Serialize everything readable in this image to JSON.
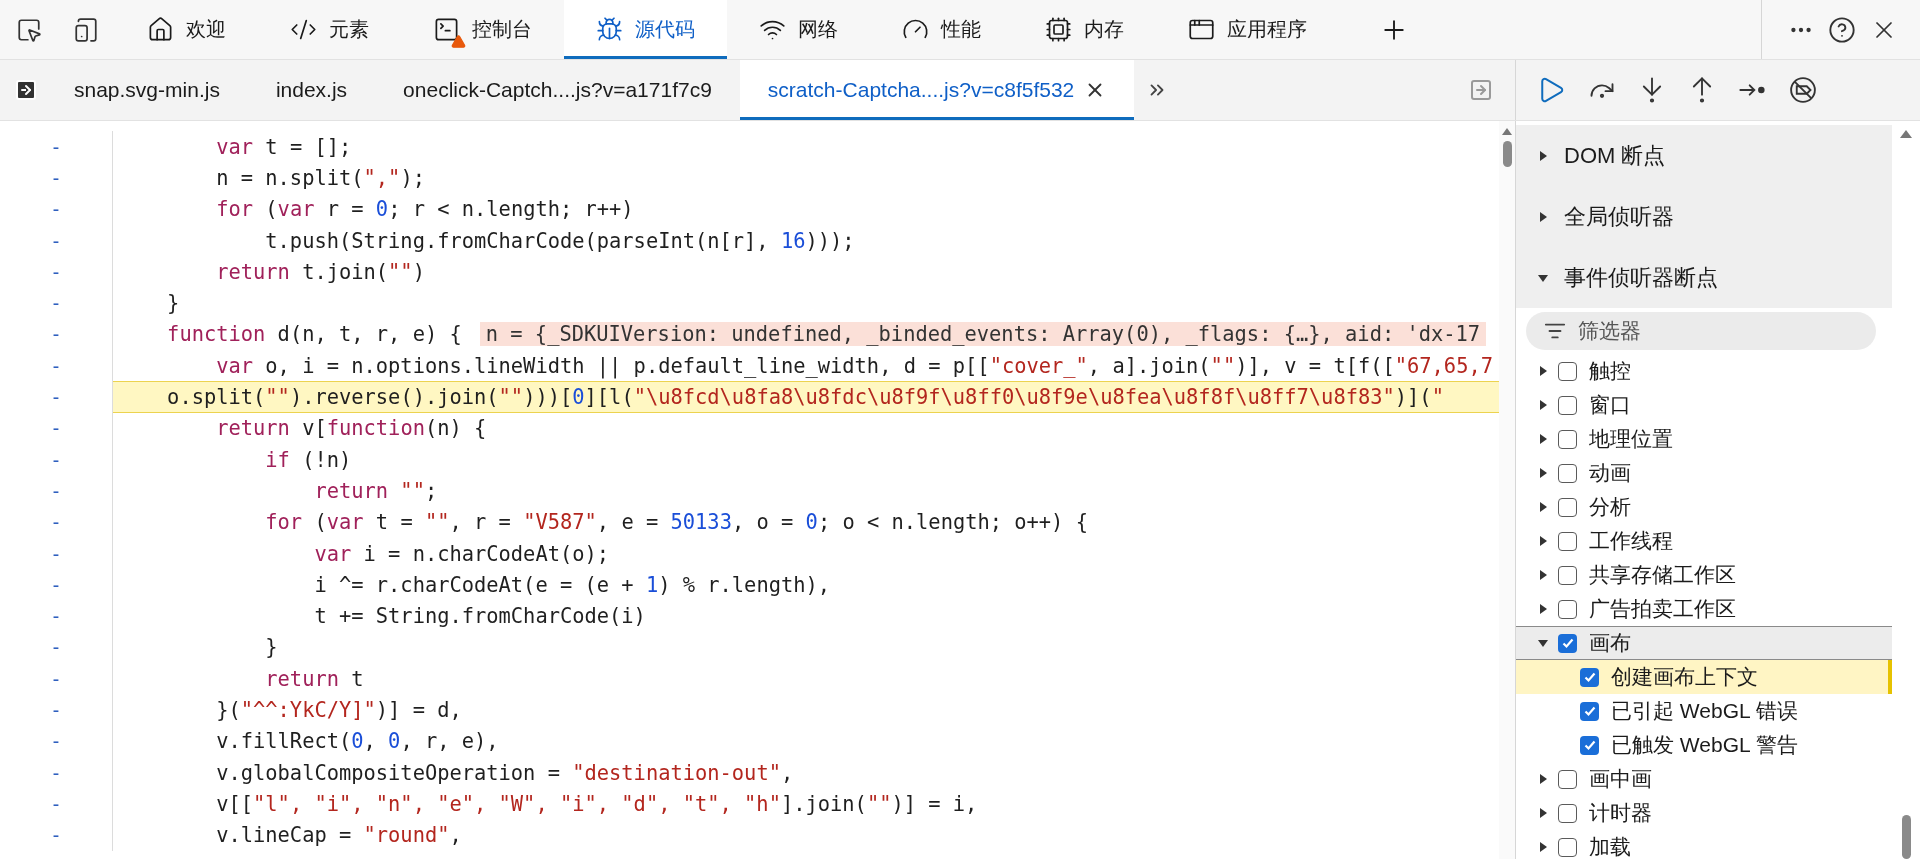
{
  "toolbar": {
    "tabs": [
      {
        "label": "欢迎",
        "selected": false,
        "warning": false
      },
      {
        "label": "元素",
        "selected": false,
        "warning": false
      },
      {
        "label": "控制台",
        "selected": false,
        "warning": true
      },
      {
        "label": "源代码",
        "selected": true,
        "warning": false
      },
      {
        "label": "网络",
        "selected": false,
        "warning": false
      },
      {
        "label": "性能",
        "selected": false,
        "warning": false
      },
      {
        "label": "内存",
        "selected": false,
        "warning": false
      },
      {
        "label": "应用程序",
        "selected": false,
        "warning": false
      }
    ]
  },
  "file_tabs": [
    {
      "label": "snap.svg-min.js",
      "selected": false
    },
    {
      "label": "index.js",
      "selected": false
    },
    {
      "label": "oneclick-Captch....js?v=a171f7c9",
      "selected": false
    },
    {
      "label": "scratch-Captcha....js?v=c8f5f532",
      "selected": true
    }
  ],
  "editor": {
    "lines": [
      {
        "gutter": "-",
        "paused": false,
        "code": [
          {
            "kind": "keyword",
            "text": "        var"
          },
          {
            "kind": "plain",
            "text": " t = [];"
          }
        ]
      },
      {
        "gutter": "-",
        "paused": false,
        "code": [
          {
            "kind": "plain",
            "text": "        n = n.split("
          },
          {
            "kind": "string",
            "text": "\",\""
          },
          {
            "kind": "plain",
            "text": ");"
          }
        ]
      },
      {
        "gutter": "-",
        "paused": false,
        "code": [
          {
            "kind": "keyword",
            "text": "        for"
          },
          {
            "kind": "plain",
            "text": " ("
          },
          {
            "kind": "keyword",
            "text": "var"
          },
          {
            "kind": "plain",
            "text": " r = "
          },
          {
            "kind": "number",
            "text": "0"
          },
          {
            "kind": "plain",
            "text": "; r < n.length; r++)"
          }
        ]
      },
      {
        "gutter": "-",
        "paused": false,
        "code": [
          {
            "kind": "plain",
            "text": "            t.push(String.fromCharCode(parseInt(n[r], "
          },
          {
            "kind": "number",
            "text": "16"
          },
          {
            "kind": "plain",
            "text": ")));"
          }
        ]
      },
      {
        "gutter": "-",
        "paused": false,
        "code": [
          {
            "kind": "keyword",
            "text": "        return"
          },
          {
            "kind": "plain",
            "text": " t.join("
          },
          {
            "kind": "string",
            "text": "\"\""
          },
          {
            "kind": "plain",
            "text": ")"
          }
        ]
      },
      {
        "gutter": "-",
        "paused": false,
        "code": [
          {
            "kind": "plain",
            "text": "    }"
          }
        ]
      },
      {
        "gutter": "-",
        "paused": false,
        "code": [
          {
            "kind": "keyword",
            "text": "    function"
          },
          {
            "kind": "plain",
            "text": " d(n, t, r, e) {"
          }
        ],
        "inline_value": "n = {_SDKUIVersion: undefined, _binded_events: Array(0), _flags: {…}, aid: 'dx-17"
      },
      {
        "gutter": "-",
        "paused": false,
        "code": [
          {
            "kind": "keyword",
            "text": "        var"
          },
          {
            "kind": "plain",
            "text": " o, i = n.options.lineWidth || p.default_line_width, d = p[["
          },
          {
            "kind": "string",
            "text": "\"cover_\""
          },
          {
            "kind": "plain",
            "text": ", a].join("
          },
          {
            "kind": "string",
            "text": "\"\""
          },
          {
            "kind": "plain",
            "text": ")], v = t[f(["
          },
          {
            "kind": "string",
            "text": "\"67,65,7"
          }
        ]
      },
      {
        "gutter": "-",
        "paused": true,
        "code": [
          {
            "kind": "plain",
            "text": "    o.split("
          },
          {
            "kind": "string",
            "text": "\"\""
          },
          {
            "kind": "plain",
            "text": ").reverse().join("
          },
          {
            "kind": "string",
            "text": "\"\""
          },
          {
            "kind": "plain",
            "text": ")))["
          },
          {
            "kind": "number",
            "text": "0"
          },
          {
            "kind": "plain",
            "text": "][l("
          },
          {
            "kind": "string",
            "text": "\"\\u8fcd\\u8fa8\\u8fdc\\u8f9f\\u8ff0\\u8f9e\\u8fea\\u8f8f\\u8ff7\\u8f83\""
          },
          {
            "kind": "plain",
            "text": ")]("
          },
          {
            "kind": "string",
            "text": "\""
          }
        ]
      },
      {
        "gutter": "-",
        "paused": false,
        "code": [
          {
            "kind": "keyword",
            "text": "        return"
          },
          {
            "kind": "plain",
            "text": " v["
          },
          {
            "kind": "keyword",
            "text": "function"
          },
          {
            "kind": "plain",
            "text": "(n) {"
          }
        ]
      },
      {
        "gutter": "-",
        "paused": false,
        "code": [
          {
            "kind": "keyword",
            "text": "            if"
          },
          {
            "kind": "plain",
            "text": " (!n)"
          }
        ]
      },
      {
        "gutter": "-",
        "paused": false,
        "code": [
          {
            "kind": "keyword",
            "text": "                return"
          },
          {
            "kind": "string",
            "text": " \"\""
          },
          {
            "kind": "plain",
            "text": ";"
          }
        ]
      },
      {
        "gutter": "-",
        "paused": false,
        "code": [
          {
            "kind": "keyword",
            "text": "            for"
          },
          {
            "kind": "plain",
            "text": " ("
          },
          {
            "kind": "keyword",
            "text": "var"
          },
          {
            "kind": "plain",
            "text": " t = "
          },
          {
            "kind": "string",
            "text": "\"\""
          },
          {
            "kind": "plain",
            "text": ", r = "
          },
          {
            "kind": "string",
            "text": "\"V587\""
          },
          {
            "kind": "plain",
            "text": ", e = "
          },
          {
            "kind": "number",
            "text": "50133"
          },
          {
            "kind": "plain",
            "text": ", o = "
          },
          {
            "kind": "number",
            "text": "0"
          },
          {
            "kind": "plain",
            "text": "; o < n.length; o++) {"
          }
        ]
      },
      {
        "gutter": "-",
        "paused": false,
        "code": [
          {
            "kind": "keyword",
            "text": "                var"
          },
          {
            "kind": "plain",
            "text": " i = n.charCodeAt(o);"
          }
        ]
      },
      {
        "gutter": "-",
        "paused": false,
        "code": [
          {
            "kind": "plain",
            "text": "                i ^= r.charCodeAt(e = (e + "
          },
          {
            "kind": "number",
            "text": "1"
          },
          {
            "kind": "plain",
            "text": ") % r.length),"
          }
        ]
      },
      {
        "gutter": "-",
        "paused": false,
        "code": [
          {
            "kind": "plain",
            "text": "                t += String.fromCharCode(i)"
          }
        ]
      },
      {
        "gutter": "-",
        "paused": false,
        "code": [
          {
            "kind": "plain",
            "text": "            }"
          }
        ]
      },
      {
        "gutter": "-",
        "paused": false,
        "code": [
          {
            "kind": "keyword",
            "text": "            return"
          },
          {
            "kind": "plain",
            "text": " t"
          }
        ]
      },
      {
        "gutter": "-",
        "paused": false,
        "code": [
          {
            "kind": "plain",
            "text": "        }("
          },
          {
            "kind": "string",
            "text": "\"^^:YkC/Y]\""
          },
          {
            "kind": "plain",
            "text": ")] = d,"
          }
        ]
      },
      {
        "gutter": "-",
        "paused": false,
        "code": [
          {
            "kind": "plain",
            "text": "        v.fillRect("
          },
          {
            "kind": "number",
            "text": "0"
          },
          {
            "kind": "plain",
            "text": ", "
          },
          {
            "kind": "number",
            "text": "0"
          },
          {
            "kind": "plain",
            "text": ", r, e),"
          }
        ]
      },
      {
        "gutter": "-",
        "paused": false,
        "code": [
          {
            "kind": "plain",
            "text": "        v.globalCompositeOperation = "
          },
          {
            "kind": "string",
            "text": "\"destination-out\""
          },
          {
            "kind": "plain",
            "text": ","
          }
        ]
      },
      {
        "gutter": "-",
        "paused": false,
        "code": [
          {
            "kind": "plain",
            "text": "        v[["
          },
          {
            "kind": "string",
            "text": "\"l\", \"i\", \"n\", \"e\", \"W\", \"i\", \"d\", \"t\", \"h\""
          },
          {
            "kind": "plain",
            "text": "].join("
          },
          {
            "kind": "string",
            "text": "\"\""
          },
          {
            "kind": "plain",
            "text": ")] = i,"
          }
        ]
      },
      {
        "gutter": "-",
        "paused": false,
        "code": [
          {
            "kind": "plain",
            "text": "        v.lineCap = "
          },
          {
            "kind": "string",
            "text": "\"round\""
          },
          {
            "kind": "plain",
            "text": ","
          }
        ]
      }
    ]
  },
  "debugger": {
    "sections": [
      {
        "label": "DOM 断点",
        "expanded": false
      },
      {
        "label": "全局侦听器",
        "expanded": false
      },
      {
        "label": "事件侦听器断点",
        "expanded": true
      }
    ],
    "filter": {
      "placeholder": "筛选器"
    },
    "categories": [
      {
        "label": "触控",
        "checked": false,
        "expanded": false
      },
      {
        "label": "窗口",
        "checked": false,
        "expanded": false
      },
      {
        "label": "地理位置",
        "checked": false,
        "expanded": false
      },
      {
        "label": "动画",
        "checked": false,
        "expanded": false
      },
      {
        "label": "分析",
        "checked": false,
        "expanded": false
      },
      {
        "label": "工作线程",
        "checked": false,
        "expanded": false
      },
      {
        "label": "共享存储工作区",
        "checked": false,
        "expanded": false
      },
      {
        "label": "广告拍卖工作区",
        "checked": false,
        "expanded": false
      },
      {
        "label": "画布",
        "checked": true,
        "expanded": true,
        "children": [
          {
            "label": "创建画布上下文",
            "checked": true,
            "selected": true
          },
          {
            "label": "已引起 WebGL 错误",
            "checked": true,
            "selected": false
          },
          {
            "label": "已触发 WebGL 警告",
            "checked": true,
            "selected": false
          }
        ]
      },
      {
        "label": "画中画",
        "checked": false,
        "expanded": false
      },
      {
        "label": "计时器",
        "checked": false,
        "expanded": false
      },
      {
        "label": "加载",
        "checked": false,
        "expanded": false
      }
    ]
  }
}
